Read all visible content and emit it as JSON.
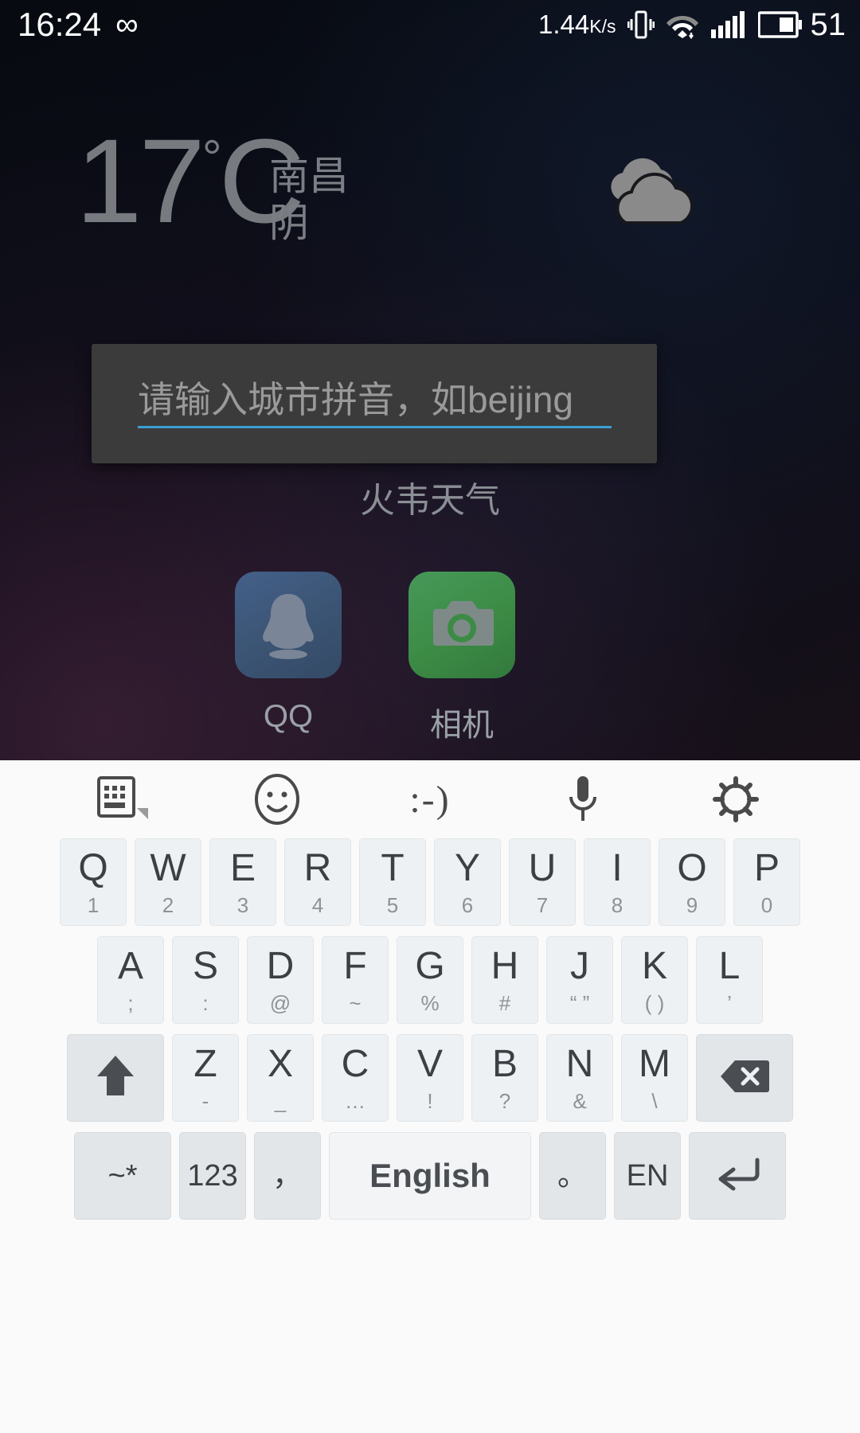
{
  "status_bar": {
    "time": "16:24",
    "infinity_icon": "infinity-icon",
    "network_speed": "1.44",
    "network_speed_unit": "K/s",
    "vibrate_icon": "vibrate-icon",
    "wifi_icon": "wifi-icon",
    "signal_icon": "signal-bars-icon",
    "battery_icon": "battery-icon",
    "battery_level": "51"
  },
  "weather": {
    "temperature": "17",
    "degree_symbol": "°",
    "unit": "C",
    "city": "南昌",
    "condition": "阴",
    "icon": "overcast-clouds-icon"
  },
  "dialog": {
    "placeholder": "请输入城市拼音，如beijing",
    "input_value": "",
    "accent_color": "#3b9fd4",
    "background_color": "#3b3b3b"
  },
  "app_title": "火韦天气",
  "apps": [
    {
      "label": "QQ",
      "icon": "qq-penguin-icon",
      "color": "#3b5473"
    },
    {
      "label": "相机",
      "icon": "camera-icon",
      "color": "#3c8b45"
    }
  ],
  "keyboard": {
    "toolbar": [
      {
        "name": "keyboard-switch-icon",
        "label": "keyboard-switch"
      },
      {
        "name": "emoji-icon",
        "label": "emoji"
      },
      {
        "name": "emoticon-icon",
        "label": ":-)"
      },
      {
        "name": "microphone-icon",
        "label": "voice-input"
      },
      {
        "name": "settings-gear-icon",
        "label": "settings"
      }
    ],
    "row1": [
      {
        "main": "Q",
        "sub": "1"
      },
      {
        "main": "W",
        "sub": "2"
      },
      {
        "main": "E",
        "sub": "3"
      },
      {
        "main": "R",
        "sub": "4"
      },
      {
        "main": "T",
        "sub": "5"
      },
      {
        "main": "Y",
        "sub": "6"
      },
      {
        "main": "U",
        "sub": "7"
      },
      {
        "main": "I",
        "sub": "8"
      },
      {
        "main": "O",
        "sub": "9"
      },
      {
        "main": "P",
        "sub": "0"
      }
    ],
    "row2": [
      {
        "main": "A",
        "sub": ";"
      },
      {
        "main": "S",
        "sub": ":"
      },
      {
        "main": "D",
        "sub": "@"
      },
      {
        "main": "F",
        "sub": "~"
      },
      {
        "main": "G",
        "sub": "%"
      },
      {
        "main": "H",
        "sub": "#"
      },
      {
        "main": "J",
        "sub": "“ ”"
      },
      {
        "main": "K",
        "sub": "( )"
      },
      {
        "main": "L",
        "sub": "’"
      }
    ],
    "row3": [
      {
        "main": "Z",
        "sub": "-"
      },
      {
        "main": "X",
        "sub": "_"
      },
      {
        "main": "C",
        "sub": "…"
      },
      {
        "main": "V",
        "sub": "!"
      },
      {
        "main": "B",
        "sub": "?"
      },
      {
        "main": "N",
        "sub": "&"
      },
      {
        "main": "M",
        "sub": "\\"
      }
    ],
    "shift_icon": "shift-arrow-icon",
    "backspace_icon": "backspace-icon",
    "row4": {
      "symbols": "~*",
      "numbers": "123",
      "comma": "，",
      "space": "English",
      "period": "。",
      "language": "EN",
      "enter_icon": "enter-arrow-icon"
    }
  }
}
